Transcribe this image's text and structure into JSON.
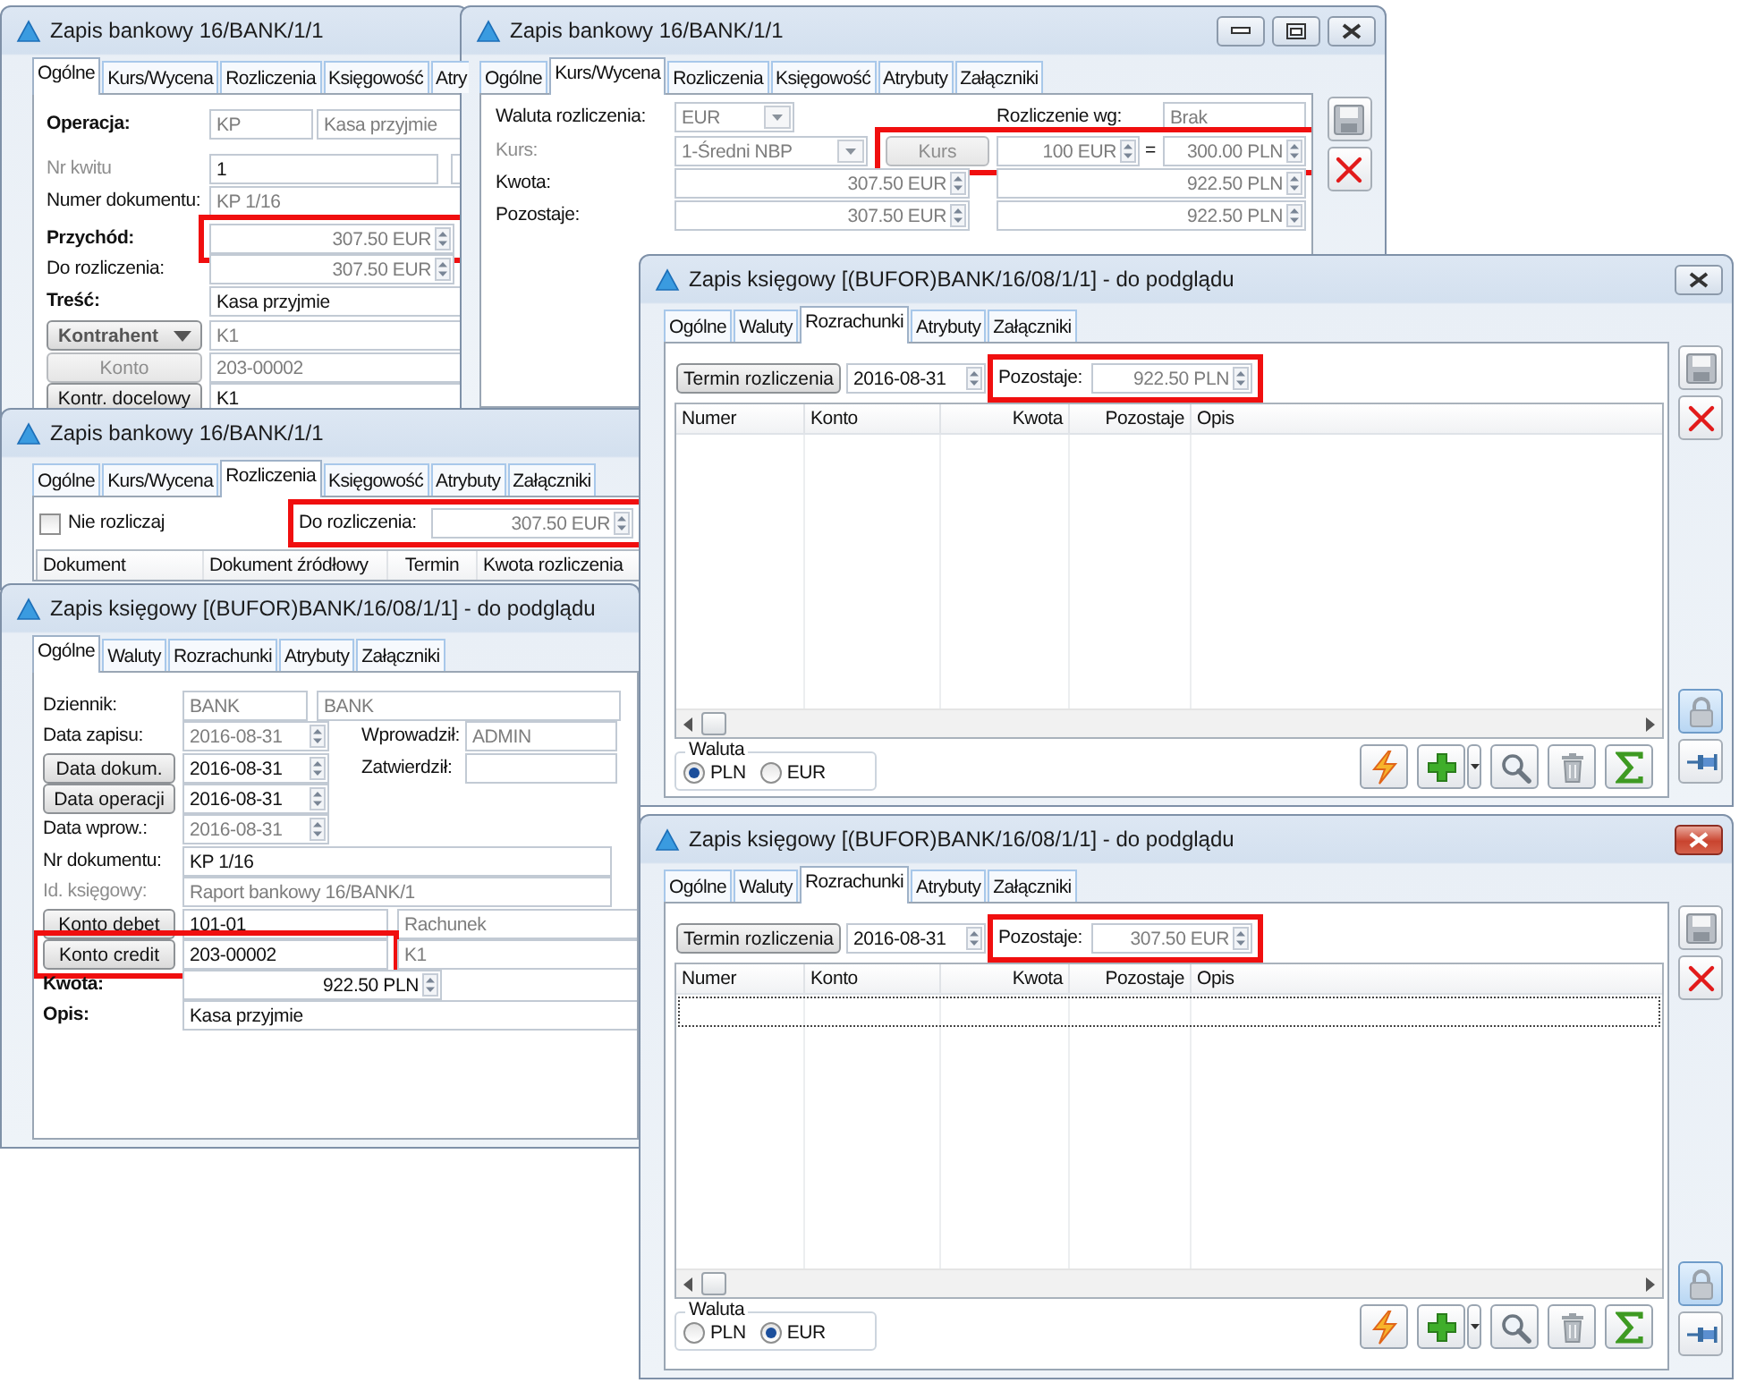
{
  "windows": [
    {
      "kind": "bank-general",
      "title": "Zapis bankowy 16/BANK/1/1",
      "tabs": [
        {
          "label": "Ogólne",
          "selected": true
        },
        {
          "label": "Kurs/Wycena",
          "selected": false
        },
        {
          "label": "Rozliczenia",
          "selected": false
        },
        {
          "label": "Księgowość",
          "selected": false
        },
        {
          "label": "Atry",
          "selected": false
        }
      ],
      "rows": [
        [
          {
            "kind": "bold-label",
            "text": "Operacja:"
          },
          {
            "kind": "text",
            "value": "KP",
            "disabled": true
          },
          {
            "kind": "text",
            "value": "Kasa przyjmie",
            "disabled": true
          }
        ],
        [
          {
            "kind": "muted-label",
            "text": "Nr kwitu"
          },
          {
            "kind": "text",
            "value": "1",
            "disabled": false
          },
          {
            "kind": "text"
          }
        ],
        [
          {
            "kind": "label",
            "text": "Numer dokumentu:"
          },
          {
            "kind": "text",
            "value": "KP 1/16",
            "disabled": true
          }
        ],
        [
          {
            "kind": "bold-label",
            "text": "Przychód:"
          },
          {
            "kind": "highlight",
            "items": [
              {
                "kind": "amount",
                "value": "307.50 EUR",
                "disabled": true
              }
            ]
          }
        ],
        [
          {
            "kind": "label",
            "text": "Do rozliczenia:"
          },
          {
            "kind": "amount",
            "value": "307.50 EUR",
            "disabled": true
          }
        ],
        [
          {
            "kind": "bold-label",
            "text": "Treść:"
          },
          {
            "kind": "text",
            "value": "Kasa przyjmie",
            "disabled": false
          }
        ],
        [
          {
            "kind": "menu-button",
            "text": "Kontrahent",
            "disabled": false
          },
          {
            "kind": "text",
            "value": "K1",
            "disabled": true
          }
        ],
        [
          {
            "kind": "button",
            "text": "Konto",
            "disabled": true
          },
          {
            "kind": "text",
            "value": "203-00002",
            "disabled": true
          }
        ],
        [
          {
            "kind": "button",
            "text": "Kontr. docelowy",
            "disabled": false
          },
          {
            "kind": "text",
            "value": "K1",
            "disabled": false
          }
        ]
      ]
    },
    {
      "kind": "bank-rate",
      "title": "Zapis bankowy 16/BANK/1/1",
      "active": false,
      "tabs": [
        {
          "label": "Ogólne",
          "selected": false
        },
        {
          "label": "Kurs/Wycena",
          "selected": true
        },
        {
          "label": "Rozliczenia",
          "selected": false
        },
        {
          "label": "Księgowość",
          "selected": false
        },
        {
          "label": "Atrybuty",
          "selected": false
        },
        {
          "label": "Załączniki",
          "selected": false
        }
      ],
      "rows": [
        [
          {
            "kind": "label",
            "text": "Waluta rozliczenia:"
          },
          {
            "kind": "combo",
            "value": "EUR",
            "disabled": true
          },
          {
            "kind": "label",
            "text": "Rozliczenie wg:"
          },
          {
            "kind": "text",
            "value": "Brak",
            "disabled": true
          }
        ],
        [
          {
            "kind": "muted-label",
            "text": "Kurs:"
          },
          {
            "kind": "combo",
            "value": "1-Średni NBP",
            "disabled": true
          },
          {
            "kind": "highlight",
            "items": [
              {
                "kind": "button",
                "text": "Kurs",
                "disabled": true
              },
              {
                "kind": "amount",
                "value": "100 EUR",
                "disabled": true
              },
              {
                "kind": "label",
                "text": "="
              },
              {
                "kind": "amount",
                "value": "300.00 PLN",
                "disabled": true
              }
            ]
          }
        ],
        [
          {
            "kind": "label",
            "text": "Kwota:"
          },
          {
            "kind": "amount",
            "value": "307.50 EUR",
            "disabled": true
          },
          {
            "kind": "amount",
            "value": "922.50 PLN",
            "disabled": true
          }
        ],
        [
          {
            "kind": "label",
            "text": "Pozostaje:"
          },
          {
            "kind": "amount",
            "value": "307.50 EUR",
            "disabled": true
          },
          {
            "kind": "amount",
            "value": "922.50 PLN",
            "disabled": true
          }
        ]
      ]
    },
    {
      "kind": "bank-settlement",
      "title": "Zapis bankowy 16/BANK/1/1",
      "tabs": [
        {
          "label": "Ogólne",
          "selected": false
        },
        {
          "label": "Kurs/Wycena",
          "selected": false
        },
        {
          "label": "Rozliczenia",
          "selected": true
        },
        {
          "label": "Księgowość",
          "selected": false
        },
        {
          "label": "Atrybuty",
          "selected": false
        },
        {
          "label": "Załączniki",
          "selected": false
        }
      ],
      "rows": [
        [
          {
            "kind": "checkbox",
            "label": "Nie rozliczaj",
            "checked": false
          },
          {
            "kind": "highlight",
            "items": [
              {
                "kind": "label",
                "text": "Do rozliczenia:"
              },
              {
                "kind": "amount",
                "value": "307.50 EUR",
                "disabled": true
              }
            ]
          }
        ]
      ],
      "table": {
        "columns": [
          "Dokument",
          "Dokument źródłowy",
          "Termin",
          "Kwota rozliczenia"
        ]
      }
    },
    {
      "kind": "ledger-general",
      "title": "Zapis księgowy [(BUFOR)BANK/16/08/1/1] - do podglądu",
      "tabs": [
        {
          "label": "Ogólne",
          "selected": true
        },
        {
          "label": "Waluty",
          "selected": false
        },
        {
          "label": "Rozrachunki",
          "selected": false
        },
        {
          "label": "Atrybuty",
          "selected": false
        },
        {
          "label": "Załączniki",
          "selected": false
        }
      ],
      "rows": [
        [
          {
            "kind": "label",
            "text": "Dziennik:"
          },
          {
            "kind": "text",
            "value": "BANK",
            "disabled": true
          },
          {
            "kind": "text",
            "value": "BANK",
            "disabled": true
          }
        ],
        [
          {
            "kind": "label",
            "text": "Data zapisu:"
          },
          {
            "kind": "date",
            "value": "2016-08-31",
            "disabled": true
          },
          {
            "kind": "label",
            "text": "Wprowadził:"
          },
          {
            "kind": "text",
            "value": "ADMIN",
            "disabled": true
          }
        ],
        [
          {
            "kind": "button",
            "text": "Data dokum.",
            "disabled": false
          },
          {
            "kind": "date",
            "value": "2016-08-31",
            "disabled": false
          },
          {
            "kind": "label",
            "text": "Zatwierdził:"
          },
          {
            "kind": "text"
          }
        ],
        [
          {
            "kind": "button",
            "text": "Data operacji",
            "disabled": false
          },
          {
            "kind": "date",
            "value": "2016-08-31",
            "disabled": false
          }
        ],
        [
          {
            "kind": "label",
            "text": "Data wprow.:"
          },
          {
            "kind": "date",
            "value": "2016-08-31",
            "disabled": true
          }
        ],
        [
          {
            "kind": "label",
            "text": "Nr dokumentu:"
          },
          {
            "kind": "text",
            "value": "KP 1/16",
            "disabled": false
          }
        ],
        [
          {
            "kind": "muted-label",
            "text": "Id. księgowy:"
          },
          {
            "kind": "text",
            "value": "Raport bankowy 16/BANK/1",
            "disabled": true
          }
        ],
        [
          {
            "kind": "button",
            "text": "Konto debet",
            "disabled": false
          },
          {
            "kind": "text",
            "value": "101-01",
            "disabled": false
          },
          {
            "kind": "text",
            "value": "Rachunek",
            "disabled": true
          }
        ],
        [
          {
            "kind": "highlight",
            "items": [
              {
                "kind": "button",
                "text": "Konto credit",
                "disabled": false
              },
              {
                "kind": "text",
                "value": "203-00002",
                "disabled": false
              }
            ]
          },
          {
            "kind": "text",
            "value": "K1",
            "disabled": true
          }
        ],
        [
          {
            "kind": "bold-label",
            "text": "Kwota:"
          },
          {
            "kind": "amount",
            "value": "922.50 PLN",
            "disabled": false
          }
        ],
        [
          {
            "kind": "bold-label",
            "text": "Opis:"
          },
          {
            "kind": "text",
            "value": "Kasa przyjmie",
            "disabled": false
          }
        ]
      ]
    },
    {
      "kind": "ledger-settlements",
      "title": "Zapis księgowy [(BUFOR)BANK/16/08/1/1] - do podglądu",
      "active": false,
      "tabs": [
        {
          "label": "Ogólne",
          "selected": false
        },
        {
          "label": "Waluty",
          "selected": false
        },
        {
          "label": "Rozrachunki",
          "selected": true
        },
        {
          "label": "Atrybuty",
          "selected": false
        },
        {
          "label": "Załączniki",
          "selected": false
        }
      ],
      "rows": [
        [
          {
            "kind": "button",
            "text": "Termin rozliczenia",
            "disabled": false
          },
          {
            "kind": "date",
            "value": "2016-08-31",
            "disabled": false
          },
          {
            "kind": "highlight",
            "items": [
              {
                "kind": "label",
                "text": "Pozostaje:"
              },
              {
                "kind": "amount",
                "value": "922.50 PLN",
                "disabled": true
              }
            ]
          }
        ]
      ],
      "table": {
        "columns": [
          "Numer",
          "Konto",
          "Kwota",
          "Pozostaje",
          "Opis"
        ],
        "focused_empty_row": false
      },
      "currency_group": {
        "label": "Waluta",
        "options": [
          {
            "label": "PLN",
            "selected": true
          },
          {
            "label": "EUR",
            "selected": false
          }
        ]
      }
    },
    {
      "kind": "ledger-settlements",
      "title": "Zapis księgowy [(BUFOR)BANK/16/08/1/1] - do podglądu",
      "active": true,
      "tabs": [
        {
          "label": "Ogólne",
          "selected": false
        },
        {
          "label": "Waluty",
          "selected": false
        },
        {
          "label": "Rozrachunki",
          "selected": true
        },
        {
          "label": "Atrybuty",
          "selected": false
        },
        {
          "label": "Załączniki",
          "selected": false
        }
      ],
      "rows": [
        [
          {
            "kind": "button",
            "text": "Termin rozliczenia",
            "disabled": false
          },
          {
            "kind": "date",
            "value": "2016-08-31",
            "disabled": false
          },
          {
            "kind": "highlight",
            "items": [
              {
                "kind": "label",
                "text": "Pozostaje:"
              },
              {
                "kind": "amount",
                "value": "307.50 EUR",
                "disabled": true
              }
            ]
          }
        ]
      ],
      "table": {
        "columns": [
          "Numer",
          "Konto",
          "Kwota",
          "Pozostaje",
          "Opis"
        ],
        "focused_empty_row": true
      },
      "currency_group": {
        "label": "Waluta",
        "options": [
          {
            "label": "PLN",
            "selected": false
          },
          {
            "label": "EUR",
            "selected": true
          }
        ]
      }
    }
  ]
}
